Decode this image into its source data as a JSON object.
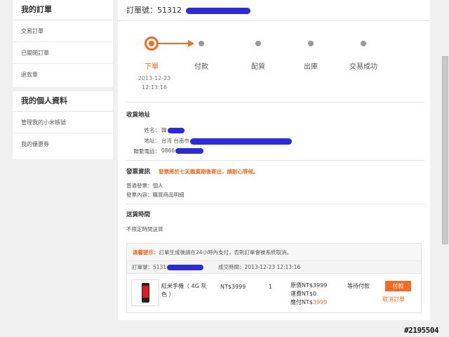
{
  "sidebar": {
    "section1": {
      "title": "我的訂單",
      "items": [
        "交易訂單",
        "已關閉訂單",
        "退款單"
      ]
    },
    "section2": {
      "title": "我的個人資料",
      "items": [
        "管理我的小米帳號",
        "我的優惠券"
      ]
    }
  },
  "order": {
    "number_label": "訂單號：",
    "number_prefix": "51312"
  },
  "progress": {
    "steps": [
      "下單",
      "付款",
      "配貨",
      "出庫",
      "交易成功"
    ],
    "active_index": 0,
    "date": "2013-12-23",
    "time": "12:13:16"
  },
  "shipping": {
    "title": "收貨地址",
    "name_label": "姓名：",
    "name_value": "韓",
    "address_label": "地址：",
    "address_value": "台湾 台南市",
    "phone_label": "聯繫電話：",
    "phone_value": "0866"
  },
  "invoice": {
    "title": "發票資訊",
    "notice": "發票將於七天鑑賞期後寄出，請耐心等候。",
    "type": "普通發票：個人",
    "content": "發票內容：購買商品明細"
  },
  "delivery": {
    "title": "送貨時間",
    "value": "不限定時間送貨"
  },
  "order_table": {
    "notice_bold": "溫馨提示",
    "notice_text": "：訂單生成後請在24小時內支付，否則訂單會被系統取消。",
    "head_order_label": "訂單號：5131",
    "head_time": "成交時間：2013-12-23 12:13:16",
    "product_line1": "紅米手機（ 4G 灰",
    "product_line2": "色 ）",
    "price": "NT$3999",
    "qty": "1",
    "orig_price": "原價NT$3999",
    "shipping_fee": "運費NT$0",
    "paid_prefix": "應付NT$",
    "paid_amount": "3999",
    "status": "等待付款",
    "pay_button": "付款",
    "cancel_link": "取消訂單"
  },
  "watermark": "#2195504",
  "colors": {
    "accent": "#f26b22",
    "redaction": "#2a2ae0"
  }
}
